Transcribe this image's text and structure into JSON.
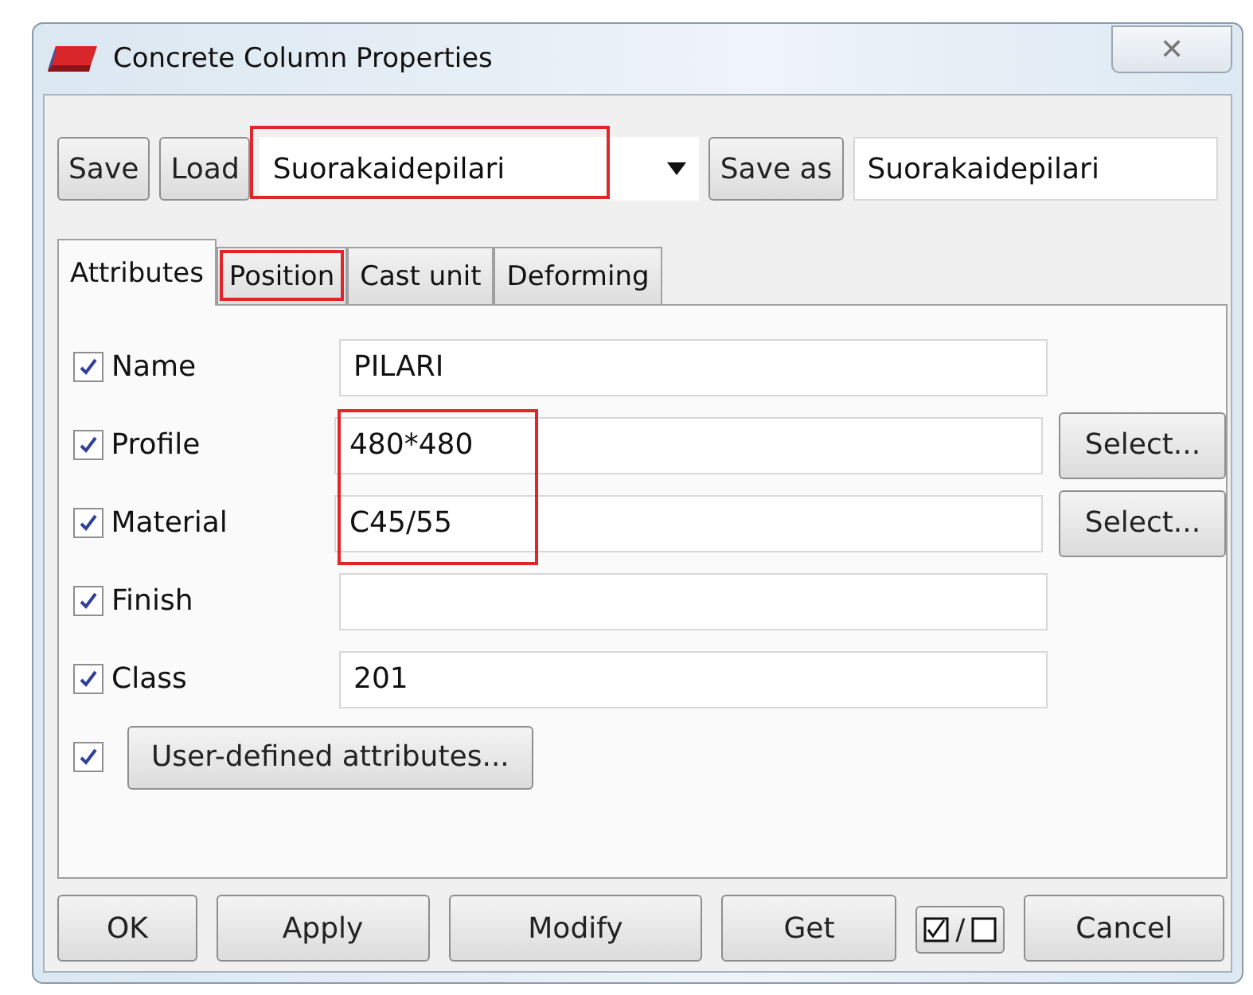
{
  "window": {
    "title": "Concrete Column Properties",
    "close": "✕"
  },
  "toolbar": {
    "save": "Save",
    "load": "Load",
    "preset": {
      "value": "Suorakaidepilari",
      "highlighted": true
    },
    "save_as": "Save as",
    "save_as_name": "Suorakaidepilari"
  },
  "tabs": [
    {
      "label": "Attributes",
      "selected": true,
      "highlighted": false
    },
    {
      "label": "Position",
      "selected": false,
      "highlighted": true
    },
    {
      "label": "Cast unit",
      "selected": false,
      "highlighted": false
    },
    {
      "label": "Deforming",
      "selected": false,
      "highlighted": false
    }
  ],
  "rows": [
    {
      "label": "Name",
      "checked": true,
      "value": "PILARI",
      "highlighted": false
    },
    {
      "label": "Profile",
      "checked": true,
      "value": "480*480",
      "button": "Select...",
      "highlighted": true
    },
    {
      "label": "Material",
      "checked": true,
      "value": "C45/55",
      "button": "Select...",
      "highlighted": true
    },
    {
      "label": "Finish",
      "checked": true,
      "value": "",
      "highlighted": false
    },
    {
      "label": "Class",
      "checked": true,
      "value": "201",
      "highlighted": false
    }
  ],
  "user_defined": {
    "checked": true,
    "label": "User-defined attributes..."
  },
  "buttons": [
    {
      "kind": "text",
      "label": "OK"
    },
    {
      "kind": "text",
      "label": "Apply"
    },
    {
      "kind": "text",
      "label": "Modify"
    },
    {
      "kind": "text",
      "label": "Get"
    },
    {
      "kind": "toggle",
      "label": "/"
    },
    {
      "kind": "text",
      "label": "Cancel"
    }
  ]
}
